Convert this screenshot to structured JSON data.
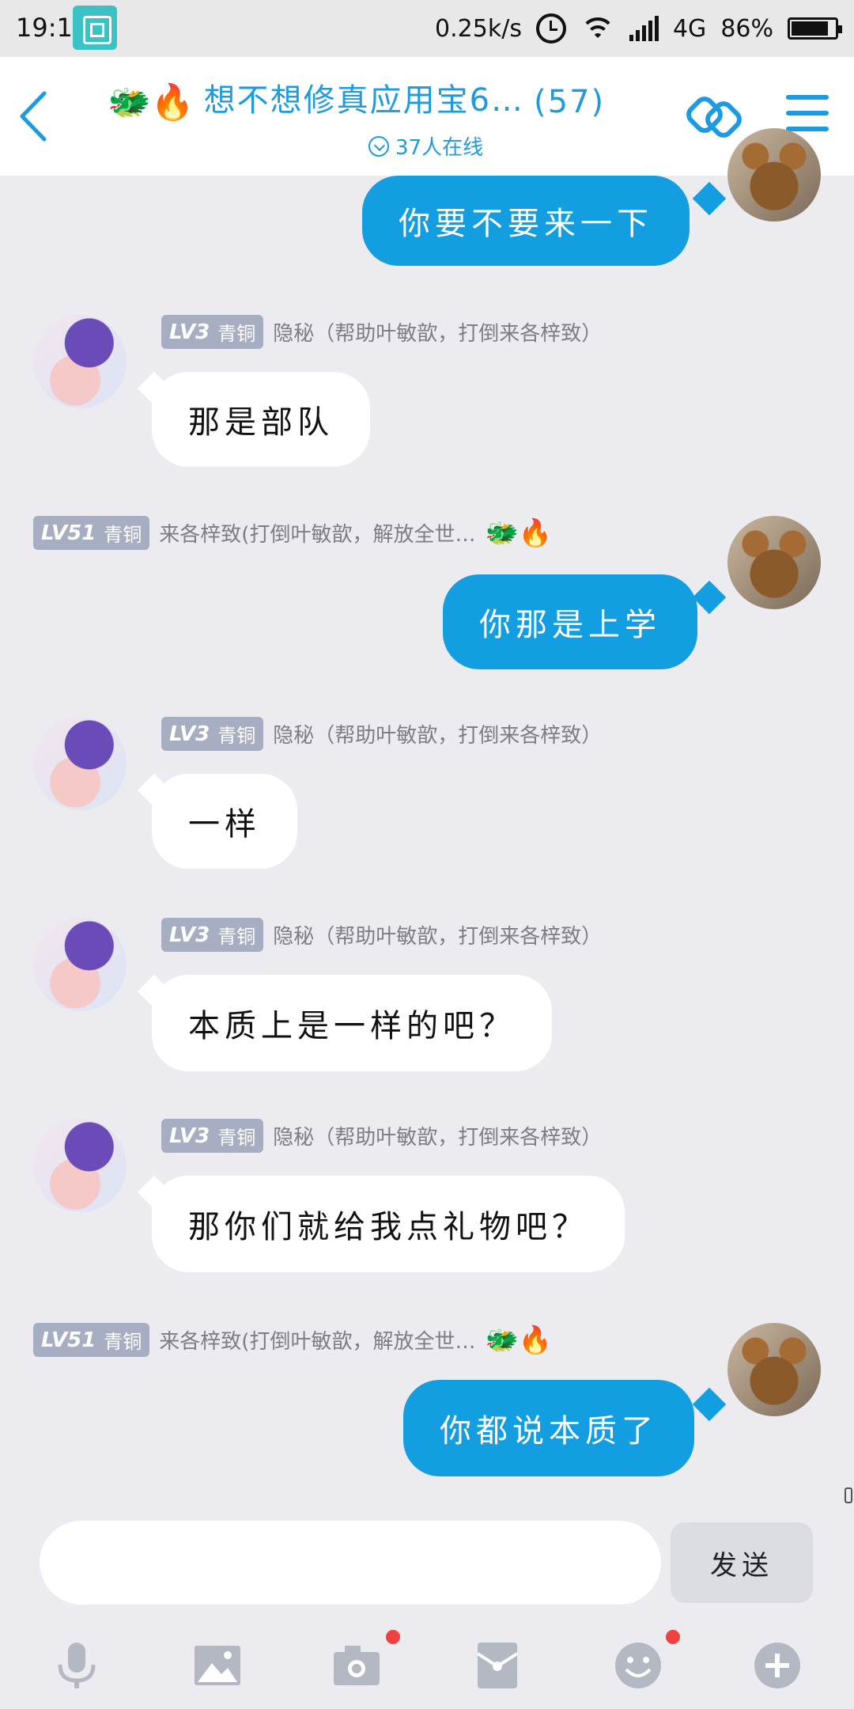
{
  "status_bar": {
    "time": "19:17",
    "net_speed": "0.25k/s",
    "network": "4G",
    "battery": "86%",
    "battery_level": 0.86
  },
  "header": {
    "title_emoji": "🐲🔥",
    "title": "想不想修真应用宝6…",
    "member_count": "(57)",
    "online": "37人在线",
    "accent_color": "#1e9be0"
  },
  "messages": [
    {
      "side": "right",
      "text": "你要不要来一下"
    },
    {
      "side": "left",
      "level": "LV3",
      "tier": "青铜",
      "sender": "隐秘（帮助叶敏歆，打倒来各梓致）",
      "text": "那是部队"
    },
    {
      "side": "right",
      "level": "LV51",
      "tier": "青铜",
      "sender": "来各梓致(打倒叶敏歆，解放全世…",
      "emoji": "🐲🔥",
      "text": "你那是上学"
    },
    {
      "side": "left",
      "level": "LV3",
      "tier": "青铜",
      "sender": "隐秘（帮助叶敏歆，打倒来各梓致）",
      "text": "一样"
    },
    {
      "side": "left",
      "level": "LV3",
      "tier": "青铜",
      "sender": "隐秘（帮助叶敏歆，打倒来各梓致）",
      "text": "本质上是一样的吧？"
    },
    {
      "side": "left",
      "level": "LV3",
      "tier": "青铜",
      "sender": "隐秘（帮助叶敏歆，打倒来各梓致）",
      "text": "那你们就给我点礼物吧？"
    },
    {
      "side": "right",
      "level": "LV51",
      "tier": "青铜",
      "sender": "来各梓致(打倒叶敏歆，解放全世…",
      "emoji": "🐲🔥",
      "text": "你都说本质了"
    }
  ],
  "composer": {
    "placeholder": "",
    "send_label": "发送"
  },
  "toolbar": {
    "icons": [
      "microphone-icon",
      "image-icon",
      "camera-icon",
      "red-packet-icon",
      "emoji-icon",
      "plus-icon"
    ]
  },
  "colors": {
    "outgoing_bubble": "#129ee0",
    "incoming_bubble": "#ffffff",
    "badge": "#a8aec2",
    "notification_dot": "#f24141"
  }
}
